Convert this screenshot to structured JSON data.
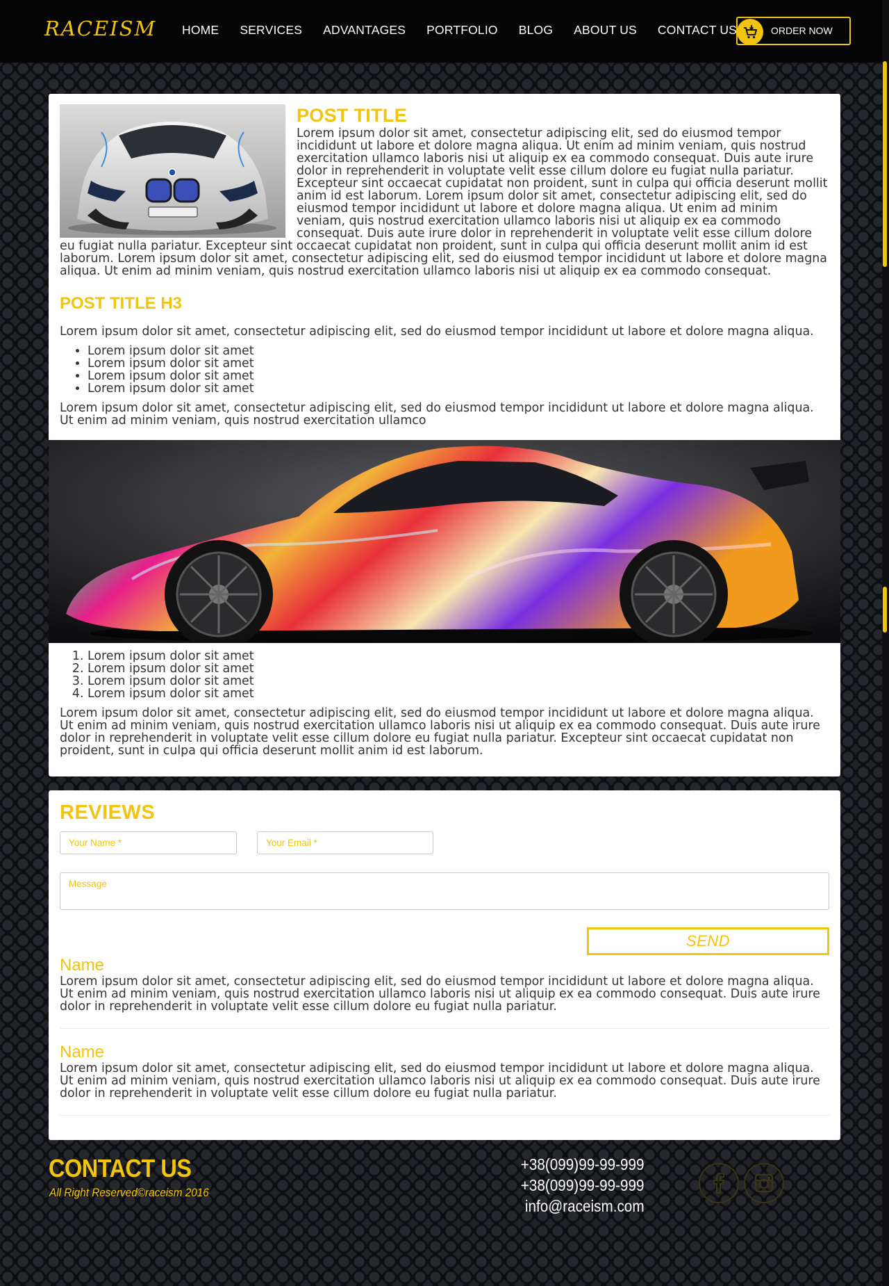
{
  "header": {
    "logo": "RACEISM",
    "nav": [
      "HOME",
      "SERVICES",
      "ADVANTAGES",
      "PORTFOLIO",
      "BLOG",
      "ABOUT US",
      "CONTACT US"
    ],
    "order_button": "ORDER NOW"
  },
  "post": {
    "title": "POST TITLE",
    "intro": "Lorem ipsum dolor sit amet, consectetur adipiscing elit, sed do eiusmod tempor incididunt ut labore et dolore magna aliqua. Ut enim ad minim veniam, quis nostrud exercitation ullamco laboris nisi ut aliquip ex ea commodo consequat. Duis aute irure dolor in reprehenderit in voluptate velit esse cillum dolore eu fugiat nulla pariatur. Excepteur sint occaecat cupidatat non proident, sunt in culpa qui officia deserunt mollit anim id est laborum. Lorem ipsum dolor sit amet, consectetur adipiscing elit, sed do eiusmod tempor incididunt ut labore et dolore magna aliqua. Ut enim ad minim veniam, quis nostrud exercitation ullamco laboris nisi ut aliquip ex ea commodo consequat. Duis aute irure dolor in reprehenderit in voluptate velit esse cillum dolore eu fugiat nulla pariatur. Excepteur sint occaecat cupidatat non proident, sunt in culpa qui officia deserunt mollit anim id est laborum. Lorem ipsum dolor sit amet, consectetur adipiscing elit, sed do eiusmod tempor incididunt ut labore et dolore magna aliqua. Ut enim ad minim veniam, quis nostrud exercitation ullamco laboris nisi ut aliquip ex ea commodo consequat.",
    "h3": "POST TITLE H3",
    "para1": "Lorem ipsum dolor sit amet, consectetur adipiscing elit, sed do eiusmod tempor incididunt ut labore et dolore magna aliqua.",
    "bullets": [
      "Lorem ipsum dolor sit amet",
      "Lorem ipsum dolor sit amet",
      "Lorem ipsum dolor sit amet",
      "Lorem ipsum dolor sit amet"
    ],
    "para2": "Lorem ipsum dolor sit amet, consectetur adipiscing elit, sed do eiusmod tempor incididunt ut labore et dolore magna aliqua. Ut enim ad minim veniam, quis nostrud exercitation ullamco",
    "numbered": [
      "Lorem ipsum dolor sit amet",
      "Lorem ipsum dolor sit amet",
      "Lorem ipsum dolor sit amet",
      "Lorem ipsum dolor sit amet"
    ],
    "para3": "Lorem ipsum dolor sit amet, consectetur adipiscing elit, sed do eiusmod tempor incididunt ut labore et dolore magna aliqua. Ut enim ad minim veniam, quis nostrud exercitation ullamco laboris nisi ut aliquip ex ea commodo consequat. Duis aute irure dolor in reprehenderit in voluptate velit esse cillum dolore eu fugiat nulla pariatur. Excepteur sint occaecat cupidatat non proident, sunt in culpa qui officia deserunt mollit anim id est laborum."
  },
  "reviews": {
    "title": "REVIEWS",
    "name_placeholder": "Your Name *",
    "email_placeholder": "Your Email *",
    "message_placeholder": "Message",
    "send_button": "SEND",
    "items": [
      {
        "name": "Name",
        "text": "Lorem ipsum dolor sit amet, consectetur adipiscing elit, sed do eiusmod tempor incididunt ut labore et dolore magna aliqua. Ut enim ad minim veniam, quis nostrud exercitation ullamco laboris nisi ut aliquip ex ea commodo consequat. Duis aute irure dolor in reprehenderit in voluptate velit esse cillum dolore eu fugiat nulla pariatur."
      },
      {
        "name": "Name",
        "text": "Lorem ipsum dolor sit amet, consectetur adipiscing elit, sed do eiusmod tempor incididunt ut labore et dolore magna aliqua. Ut enim ad minim veniam, quis nostrud exercitation ullamco laboris nisi ut aliquip ex ea commodo consequat. Duis aute irure dolor in reprehenderit in voluptate velit esse cillum dolore eu fugiat nulla pariatur."
      }
    ]
  },
  "footer": {
    "title": "CONTACT US",
    "copyright": "All Right Reserved©raceism 2016",
    "phone1": "+38(099)99-99-999",
    "phone2": "+38(099)99-99-999",
    "email": "info@raceism.com"
  },
  "icons": {
    "cart": "cart-icon",
    "facebook": "facebook-icon",
    "instagram": "instagram-icon"
  },
  "colors": {
    "accent": "#f1c40f",
    "header_bg": "#050506",
    "card_bg": "#ffffff"
  }
}
